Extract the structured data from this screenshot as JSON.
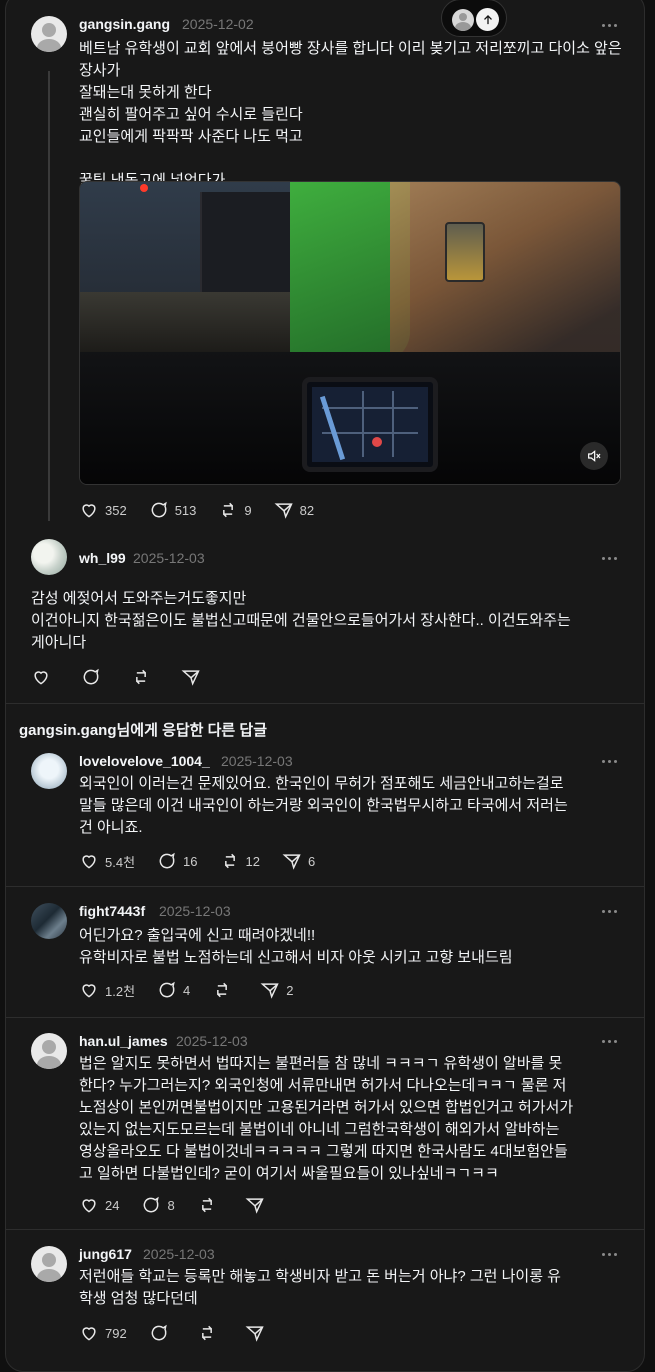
{
  "main_post": {
    "username": "gangsin.gang",
    "date": "2025-12-02",
    "text": "베트남 유학생이 교회 앞에서 붕어빵 장사를 합니다 이리 봊기고 저리쪼끼고 다이소 앞은 장사가\n잘돼는대 못하게 한다\n괜실히 팔어주고 싶어 수시로 들린다\n교인들에게 팍팍팍 사준다 나도 먹고\n\n꿀팁 냉동고에 넣엇다가",
    "likes": "352",
    "replies": "513",
    "reposts": "9",
    "shares": "82"
  },
  "reply_1": {
    "username": "wh_l99",
    "date": "2025-12-03",
    "text": "감성 에젖어서 도와주는거도좋지만\n이건아니지 한국젊은이도 불법신고때문에 건물안으로들어가서 장사한다.. 이건도와주는\n게아니다"
  },
  "section_title": "gangsin.gang님에게 응답한 다른 답글",
  "replies": [
    {
      "username": "lovelovelove_1004_",
      "date": "2025-12-03",
      "text": "외국인이 이러는건 문제있어요. 한국인이 무허가 점포해도 세금안내고하는걸로\n말들 많은데 이건 내국인이 하는거랑 외국인이 한국법무시하고 타국에서 저러는\n건 아니죠.",
      "likes": "5.4천",
      "replies": "16",
      "reposts": "12",
      "shares": "6"
    },
    {
      "username": "fight7443f",
      "date": "2025-12-03",
      "text": "어딘가요? 출입국에 신고 때려야겠네!!\n유학비자로 불법 노점하는데 신고해서 비자 아웃 시키고 고향 보내드림",
      "likes": "1.2천",
      "replies": "4",
      "reposts": "",
      "shares": "2"
    },
    {
      "username": "han.ul_james",
      "date": "2025-12-03",
      "text": "법은 알지도 못하면서 법따지는 불편러들 참 많네 ㅋㅋㅋㄱ 유학생이 알바를 못\n한다? 누가그러는지? 외국인청에 서류만내면 허가서 다나오는데ㅋㅋㄱ 물론 저\n노점상이 본인꺼면불법이지만 고용된거라면 허가서 있으면 합법인거고 허가서가\n있는지 없는지도모르는데 불법이네 아니네 그럼한국학생이 해외가서 알바하는\n영상올라오도 다 불법이것네ㅋㅋㅋㅋㅋ 그렇게 따지면 한국사람도 4대보험안들\n고 일하면 다불법인데? 굳이 여기서 싸울필요들이 있나싶네ㅋㄱㅋㅋ",
      "likes": "24",
      "replies": "8",
      "reposts": "",
      "shares": ""
    },
    {
      "username": "jung617",
      "date": "2025-12-03",
      "text": "저런애들 학교는 등록만 해놓고 학생비자 받고 돈 버는거 아냐? 그런 나이롱 유\n학생 엄청 많다던데",
      "likes": "792",
      "replies": "",
      "reposts": "",
      "shares": ""
    }
  ],
  "icons": {
    "like": "heart-icon",
    "reply": "comment-icon",
    "repost": "repost-icon",
    "share": "send-icon",
    "more": "more-icon",
    "mute": "mute-icon",
    "scroll_top": "arrow-up-icon"
  },
  "colors": {
    "background": "#101010",
    "panel": "#181818",
    "text": "#f3f5f7",
    "muted": "#777777",
    "divider": "#2d2d2d"
  }
}
